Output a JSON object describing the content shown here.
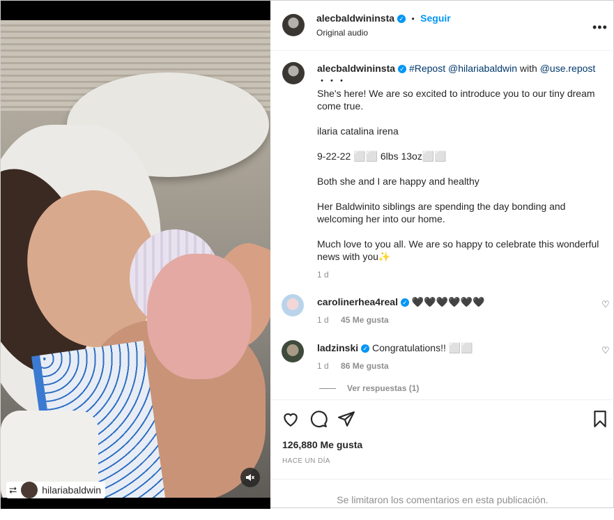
{
  "media": {
    "repost_user": "hilariabaldwin",
    "repost_icon": "repost-icon",
    "mute_icon": "speaker-muted-icon"
  },
  "header": {
    "username": "alecbaldwininsta",
    "dot": "•",
    "follow_label": "Seguir",
    "audio": "Original audio",
    "more": "•••"
  },
  "caption": {
    "username": "alecbaldwininsta",
    "repost_tag": "#Repost",
    "repost_mention": "@hilariabaldwin",
    "with_word": "with",
    "app_mention": "@use.repost",
    "dots": "・・・",
    "line1": "She's here! We are so excited to introduce you to our tiny dream come true.",
    "line2": "ilaria catalina irena",
    "line3": "9-22-22 ⬜⬜ 6lbs 13oz⬜⬜",
    "line4": "Both she and I are happy and healthy",
    "line5": "Her Baldwinito siblings are spending the day bonding and welcoming her into our home.",
    "line6": "Much love to you all. We are so happy to celebrate this wonderful news with you✨",
    "time": "1 d"
  },
  "comments": [
    {
      "username": "carolinerhea4real",
      "text": "🖤🖤🖤🖤🖤🖤",
      "time": "1 d",
      "likes": "45 Me gusta"
    },
    {
      "username": "ladzinski",
      "text": "Congratulations!! ⬜⬜",
      "time": "1 d",
      "likes": "86 Me gusta"
    }
  ],
  "replies_label": "Ver respuestas (1)",
  "footer": {
    "likes": "126,880 Me gusta",
    "time": "HACE UN DÍA",
    "limited": "Se limitaron los comentarios en esta publicación."
  },
  "colors": {
    "accent": "#0095f6",
    "mention": "#00376b",
    "muted": "#8e8e8e"
  }
}
